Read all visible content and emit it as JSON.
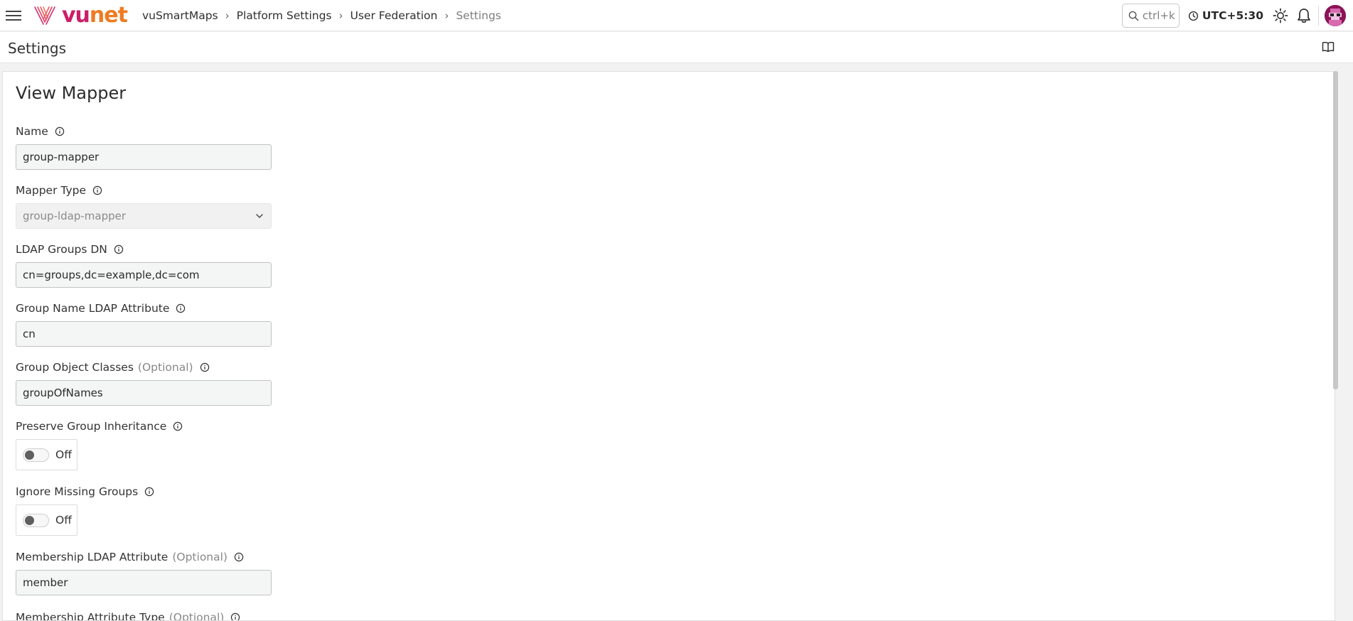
{
  "header": {
    "logo_text_vu": "vu",
    "logo_text_net": "net",
    "breadcrumb": [
      "vuSmartMaps",
      "Platform Settings",
      "User Federation",
      "Settings"
    ],
    "search_hint": "ctrl+k",
    "timezone": "UTC+5:30",
    "icons": [
      "menu-icon",
      "search-icon",
      "clock-icon",
      "sun-icon",
      "bell-icon",
      "book-icon"
    ]
  },
  "page": {
    "title": "Settings"
  },
  "form": {
    "title": "View Mapper",
    "name": {
      "label": "Name",
      "value": "group-mapper"
    },
    "mapper_type": {
      "label": "Mapper Type",
      "value": "group-ldap-mapper"
    },
    "ldap_groups_dn": {
      "label": "LDAP Groups DN",
      "value": "cn=groups,dc=example,dc=com"
    },
    "group_name_attr": {
      "label": "Group Name LDAP Attribute",
      "value": "cn"
    },
    "group_object_classes": {
      "label": "Group Object Classes",
      "optional": "(Optional)",
      "value": "groupOfNames"
    },
    "preserve_inheritance": {
      "label": "Preserve Group Inheritance",
      "state": "Off"
    },
    "ignore_missing": {
      "label": "Ignore Missing Groups",
      "state": "Off"
    },
    "membership_attr": {
      "label": "Membership LDAP Attribute",
      "optional": "(Optional)",
      "value": "member"
    },
    "membership_attr_type": {
      "label": "Membership Attribute Type",
      "optional": "(Optional)"
    }
  },
  "colors": {
    "brand_vu": "#cc1f68",
    "brand_net": "#ef7b22",
    "avatar_bg": "#8b1457"
  }
}
